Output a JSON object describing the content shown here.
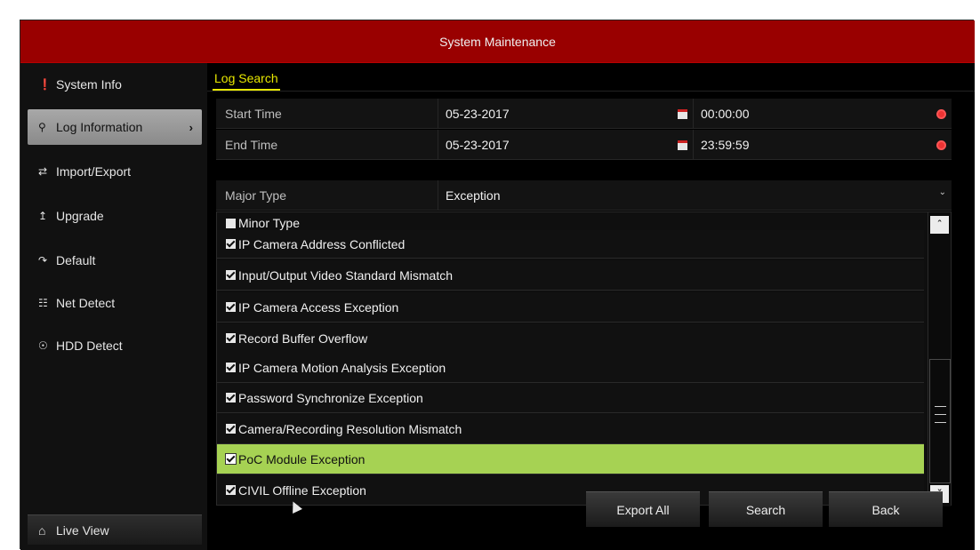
{
  "window": {
    "title": "System Maintenance"
  },
  "sidebar": {
    "items": [
      {
        "label": "System Info",
        "icon": "info-icon"
      },
      {
        "label": "Log Information",
        "icon": "log-search-icon",
        "active": true
      },
      {
        "label": "Import/Export",
        "icon": "import-export-icon"
      },
      {
        "label": "Upgrade",
        "icon": "upgrade-icon"
      },
      {
        "label": "Default",
        "icon": "default-icon"
      },
      {
        "label": "Net Detect",
        "icon": "network-icon"
      },
      {
        "label": "HDD Detect",
        "icon": "hdd-icon"
      }
    ],
    "live_view": "Live View"
  },
  "main": {
    "tab": "Log Search",
    "start_time": {
      "label": "Start Time",
      "date": "05-23-2017",
      "time": "00:00:00"
    },
    "end_time": {
      "label": "End Time",
      "date": "05-23-2017",
      "time": "23:59:59"
    },
    "major_type": {
      "label": "Major Type",
      "value": "Exception"
    },
    "minor_type": {
      "label": "Minor Type",
      "items": [
        "IP Camera Address Conflicted",
        "Input/Output Video Standard Mismatch",
        "IP Camera Access Exception",
        "Record Buffer Overflow",
        "IP Camera Motion Analysis Exception",
        "Password Synchronize Exception",
        "Camera/Recording Resolution Mismatch",
        "PoC Module Exception",
        "CIVIL Offline Exception"
      ]
    }
  },
  "buttons": {
    "export_all": "Export All",
    "search": "Search",
    "back": "Back"
  },
  "colors": {
    "title_bar": "#990000",
    "selection": "#a6d253",
    "tab_accent": "#e8e800"
  }
}
